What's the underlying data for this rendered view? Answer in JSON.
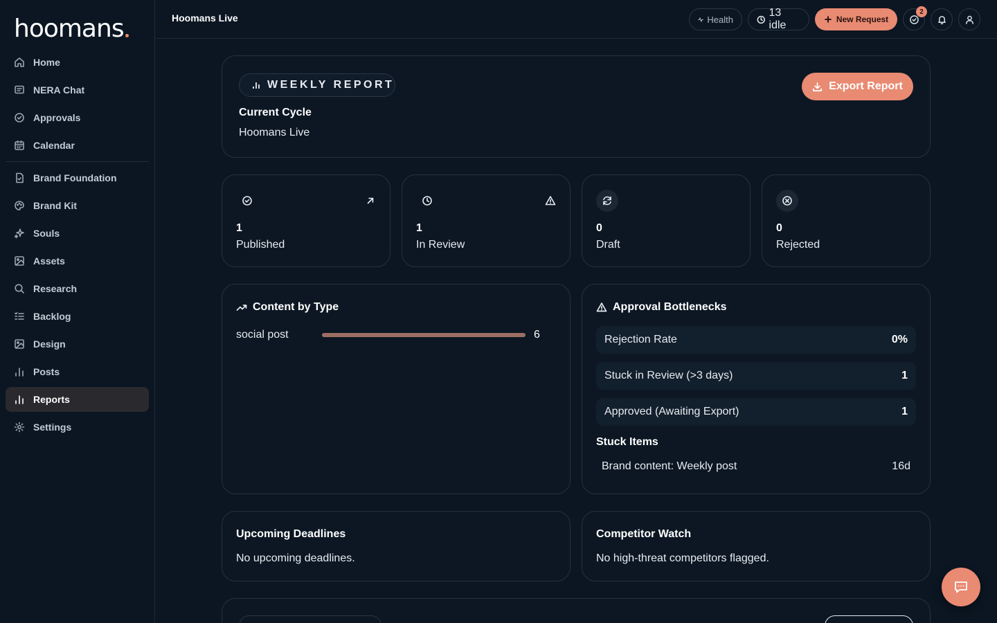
{
  "logo": "hoomans",
  "sidebar": {
    "items": [
      {
        "label": "Home",
        "icon": "home-icon"
      },
      {
        "label": "NERA Chat",
        "icon": "chat-icon"
      },
      {
        "label": "Approvals",
        "icon": "check-circle-icon"
      },
      {
        "label": "Calendar",
        "icon": "calendar-icon"
      },
      {
        "label": "Brand Foundation",
        "icon": "document-icon"
      },
      {
        "label": "Brand Kit",
        "icon": "palette-icon"
      },
      {
        "label": "Souls",
        "icon": "sparkle-icon"
      },
      {
        "label": "Assets",
        "icon": "image-icon"
      },
      {
        "label": "Research",
        "icon": "search-icon"
      },
      {
        "label": "Backlog",
        "icon": "list-icon"
      },
      {
        "label": "Design",
        "icon": "image-icon"
      },
      {
        "label": "Posts",
        "icon": "bar-chart-icon"
      },
      {
        "label": "Reports",
        "icon": "bar-chart-icon",
        "active": true
      },
      {
        "label": "Settings",
        "icon": "gear-icon"
      }
    ]
  },
  "topbar": {
    "title": "Hoomans Live",
    "health_label": "Health",
    "idle_label": "13 idle",
    "new_request_label": "New Request",
    "approvals_badge": "2"
  },
  "report": {
    "badge_label": "WEEKLY REPORT",
    "cycle_label": "Current Cycle",
    "cycle_value": "Hoomans Live",
    "export_label": "Export Report"
  },
  "stats": [
    {
      "value": "1",
      "label": "Published",
      "icon": "check-circle-icon",
      "corner_icon": "arrow-up-right-icon"
    },
    {
      "value": "1",
      "label": "In Review",
      "icon": "clock-icon",
      "corner_icon": "warning-icon"
    },
    {
      "value": "0",
      "label": "Draft",
      "icon": "refresh-icon"
    },
    {
      "value": "0",
      "label": "Rejected",
      "icon": "x-circle-icon"
    }
  ],
  "content_by_type": {
    "title": "Content by Type",
    "rows": [
      {
        "label": "social post",
        "value": "6",
        "fill": 1.0
      }
    ]
  },
  "bottlenecks": {
    "title": "Approval Bottlenecks",
    "rows": [
      {
        "label": "Rejection Rate",
        "value": "0%"
      },
      {
        "label": "Stuck in Review (>3 days)",
        "value": "1"
      },
      {
        "label": "Approved (Awaiting Export)",
        "value": "1"
      }
    ],
    "stuck_title": "Stuck Items",
    "stuck_items": [
      {
        "label": "Brand content: Weekly post",
        "age": "16d"
      }
    ]
  },
  "deadlines": {
    "title": "Upcoming Deadlines",
    "body": "No upcoming deadlines."
  },
  "competitors": {
    "title": "Competitor Watch",
    "body": "No high-threat competitors flagged."
  },
  "colors": {
    "accent": "#e98a72",
    "background": "#0b1622",
    "bar_fill": "#9c6e62"
  }
}
